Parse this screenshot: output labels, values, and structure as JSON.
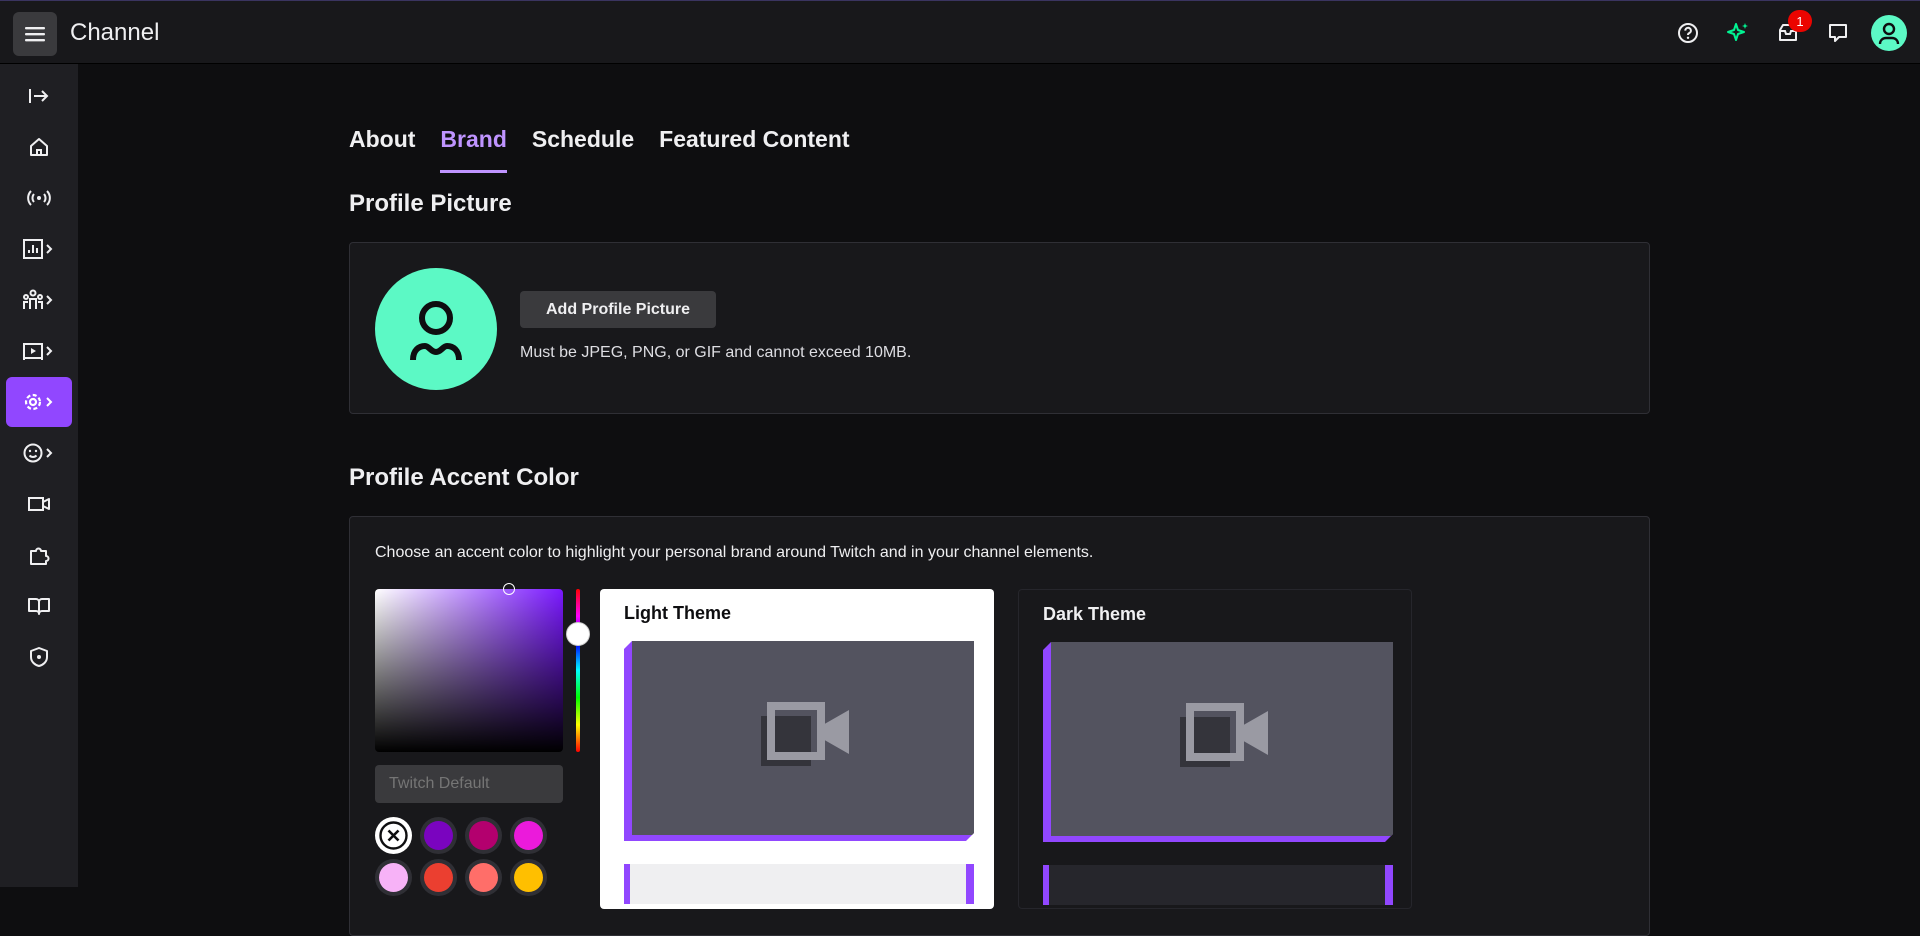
{
  "header": {
    "title": "Channel",
    "inbox_badge": "1",
    "icons": [
      "menu-icon",
      "help-icon",
      "sparkle-icon",
      "inbox-icon",
      "whispers-icon",
      "user-avatar-icon"
    ]
  },
  "sidebar": {
    "items": [
      {
        "name": "collapse",
        "icon": "arrow-to-right-icon"
      },
      {
        "name": "home",
        "icon": "home-icon"
      },
      {
        "name": "stream",
        "icon": "broadcast-icon"
      },
      {
        "name": "analytics",
        "icon": "analytics-icon"
      },
      {
        "name": "community",
        "icon": "community-icon"
      },
      {
        "name": "content",
        "icon": "content-icon"
      },
      {
        "name": "settings",
        "icon": "gear-icon",
        "active": true
      },
      {
        "name": "viewer-rewards",
        "icon": "emote-icon"
      },
      {
        "name": "creator-camp",
        "icon": "camera-icon"
      },
      {
        "name": "extensions",
        "icon": "puzzle-icon"
      },
      {
        "name": "learn",
        "icon": "book-icon"
      },
      {
        "name": "safety",
        "icon": "shield-icon"
      }
    ]
  },
  "tabs": [
    {
      "label": "About"
    },
    {
      "label": "Brand",
      "active": true
    },
    {
      "label": "Schedule"
    },
    {
      "label": "Featured Content"
    }
  ],
  "profile_picture": {
    "title": "Profile Picture",
    "button_label": "Add Profile Picture",
    "hint": "Must be JPEG, PNG, or GIF and cannot exceed 10MB."
  },
  "accent": {
    "title": "Profile Accent Color",
    "description": "Choose an accent color to highlight your personal brand around Twitch and in your channel elements.",
    "input_placeholder": "Twitch Default",
    "swatches": [
      "none",
      "#7a04bf",
      "#b3006e",
      "#eb1adb",
      "#f7b2f7",
      "#eb3f30",
      "#ff6e69",
      "#ffbf00"
    ],
    "light_theme_label": "Light Theme",
    "dark_theme_label": "Dark Theme"
  },
  "colors": {
    "accent": "#9147ff",
    "avatar": "#5cf9c5",
    "brand_tab": "#bf94ff"
  }
}
